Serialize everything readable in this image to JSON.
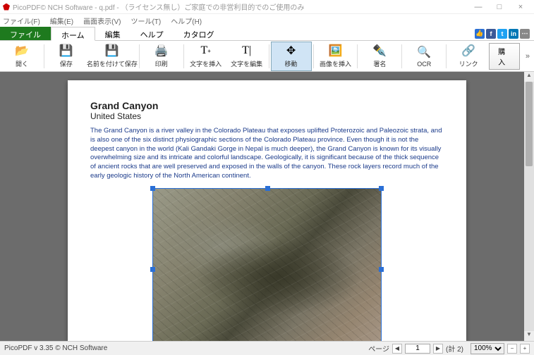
{
  "window": {
    "title": "PicoPDF© NCH Software - q.pdf - （ライセンス無し）ご家庭での非営利目的でのご使用のみ",
    "minimize": "—",
    "maximize": "□",
    "close": "×"
  },
  "menubar": {
    "file": "ファイル(F)",
    "edit": "編集(E)",
    "view": "画面表示(V)",
    "tool": "ツール(T)",
    "help": "ヘルプ(H)"
  },
  "tabs": {
    "file": "ファイル",
    "home": "ホーム",
    "edit": "編集",
    "help": "ヘルプ",
    "catalog": "カタログ"
  },
  "toolbar": {
    "open": "開く",
    "save": "保存",
    "saveas": "名前を付けて保存",
    "print": "印刷",
    "inserttext": "文字を挿入",
    "edittext": "文字を編集",
    "move": "移動",
    "insertimage": "画像を挿入",
    "sign": "署名",
    "ocr": "OCR",
    "link": "リンク",
    "buy": "購入",
    "more": "»"
  },
  "doc": {
    "title": "Grand Canyon",
    "subtitle": "United States",
    "body": "The Grand Canyon is a river valley in the Colorado Plateau that exposes uplifted Proterozoic and Paleozoic strata, and is also one of the six distinct physiographic sections of the Colorado Plateau province. Even though it is not the deepest canyon in the world (Kali Gandaki Gorge in Nepal is much deeper), the Grand Canyon is known for its visually overwhelming size and its intricate and colorful landscape. Geologically, it is significant because of the thick sequence of ancient rocks that are well preserved and exposed in the walls of the canyon. These rock layers record much of the early geologic history of the North American continent."
  },
  "status": {
    "version": "PicoPDF v 3.35 © NCH Software",
    "page_label": "ページ",
    "page_current": "1",
    "page_total": "(計 2)",
    "zoom": "100%"
  }
}
